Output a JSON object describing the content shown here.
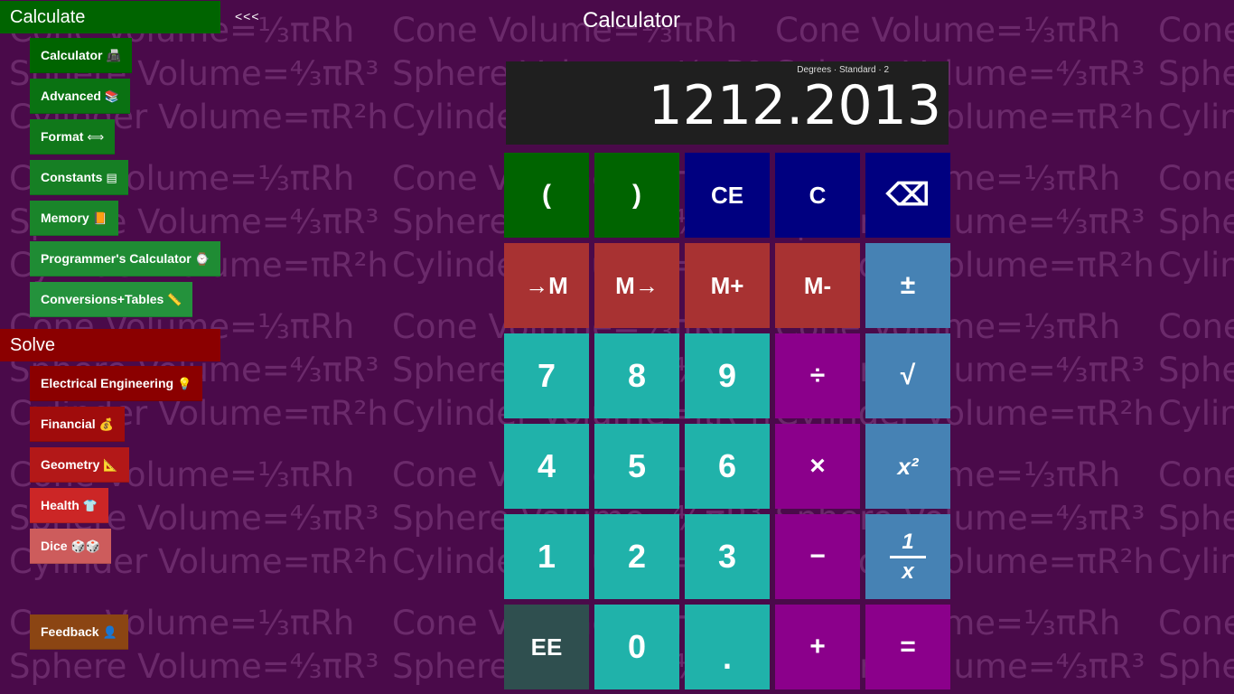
{
  "background_text": {
    "cone": "Cone Volume=⅓πRh",
    "sphere": "Sphere Volume=⁴⁄₃πR³",
    "cylinder": "Cylinder Volume=πR²h"
  },
  "nav": {
    "collapse_label": "<<<",
    "calculate_header": "Calculate",
    "calculate_items": [
      {
        "label": "Calculator",
        "icon": "📠"
      },
      {
        "label": "Advanced",
        "icon": "📚"
      },
      {
        "label": "Format",
        "icon": "⟺"
      },
      {
        "label": "Constants",
        "icon": "▤"
      },
      {
        "label": "Memory",
        "icon": "📙"
      },
      {
        "label": "Programmer's Calculator",
        "icon": "⌚"
      },
      {
        "label": "Conversions+Tables",
        "icon": "📏"
      }
    ],
    "solve_header": "Solve",
    "solve_items": [
      {
        "label": "Electrical Engineering",
        "icon": "💡"
      },
      {
        "label": "Financial",
        "icon": "💰"
      },
      {
        "label": "Geometry",
        "icon": "📐"
      },
      {
        "label": "Health",
        "icon": "👕"
      },
      {
        "label": "Dice",
        "icon": "🎲🎲"
      }
    ],
    "feedback": {
      "label": "Feedback",
      "icon": "👤"
    }
  },
  "title": "Calculator",
  "display": {
    "status": "Degrees  ·  Standard  ·  2",
    "value": "1212.2013"
  },
  "keys": {
    "open_paren": "(",
    "close_paren": ")",
    "ce": "CE",
    "c": "C",
    "backspace": "⌫",
    "mem_store": "→M",
    "mem_recall": "M→",
    "mem_plus": "M+",
    "mem_minus": "M-",
    "plus_minus": "±",
    "seven": "7",
    "eight": "8",
    "nine": "9",
    "divide": "÷",
    "sqrt": "√",
    "four": "4",
    "five": "5",
    "six": "6",
    "multiply": "×",
    "square": "x²",
    "one": "1",
    "two": "2",
    "three": "3",
    "minus": "−",
    "reciprocal_num": "1",
    "reciprocal_den": "x",
    "ee": "EE",
    "zero": "0",
    "decimal": ".",
    "plus": "+",
    "equals": "="
  },
  "colors": {
    "background": "#4a0a4a",
    "calculate_green": "#006400",
    "solve_red": "#8b0000",
    "teal": "#20b2aa",
    "purple": "#8b008b",
    "steel": "#4682b4",
    "navy": "#000080"
  }
}
